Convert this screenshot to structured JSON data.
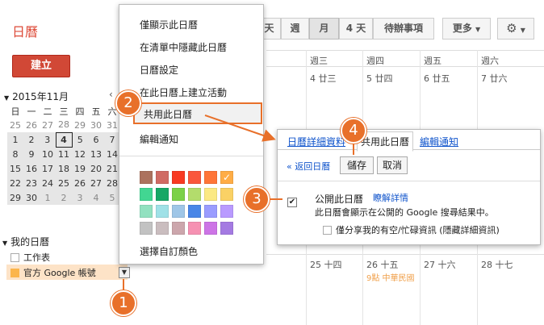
{
  "brand": "日曆",
  "create_label": "建立",
  "mini_cal": {
    "title": "2015年11月",
    "prev": "‹",
    "weekdays": [
      "日",
      "一",
      "二",
      "三",
      "四",
      "五",
      "六"
    ],
    "weeks": [
      [
        "25",
        "26",
        "27",
        "28",
        "29",
        "30",
        "31"
      ],
      [
        "1",
        "2",
        "3",
        "4",
        "5",
        "6",
        "7"
      ],
      [
        "8",
        "9",
        "10",
        "11",
        "12",
        "13",
        "14"
      ],
      [
        "15",
        "16",
        "17",
        "18",
        "19",
        "20",
        "21"
      ],
      [
        "22",
        "23",
        "24",
        "25",
        "26",
        "27",
        "28"
      ],
      [
        "29",
        "30",
        "1",
        "2",
        "3",
        "4",
        "5"
      ]
    ]
  },
  "my_calendars": {
    "title": "我的日曆",
    "items": [
      "工作表",
      "官方 Google 帳號"
    ]
  },
  "toolbar": {
    "day_label": "天",
    "week_label": "週",
    "month_label": "月",
    "four_days_label": "4 天",
    "agenda_label": "待辦事項",
    "more_label": "更多",
    "settings_icon": "⚙"
  },
  "grid": {
    "col_heads": [
      "週三",
      "週四",
      "週五",
      "週六"
    ],
    "row1": [
      "4 廿三",
      "5 廿四",
      "6 廿五",
      "7 廿六"
    ],
    "row5": [
      "25 十四",
      "26 十五",
      "27 十六",
      "28 十七"
    ],
    "event": "9點 中華民國"
  },
  "menu": {
    "items": [
      "僅顯示此日曆",
      "在清單中隱藏此日曆",
      "日曆設定",
      "在此日曆上建立活動",
      "共用此日曆",
      "編輯通知"
    ],
    "custom_color": "選擇自訂顏色",
    "colors": [
      [
        "#ac725e",
        "#d06b64",
        "#f83a22",
        "#fa573c",
        "#ff7537",
        "#ffad46"
      ],
      [
        "#42d692",
        "#16a765",
        "#7bd148",
        "#b3dc6c",
        "#fbe983",
        "#fad165"
      ],
      [
        "#92e1c0",
        "#9fe1e7",
        "#9fc6e7",
        "#4986e7",
        "#9a9cff",
        "#b99aff"
      ],
      [
        "#c2c2c2",
        "#cabdbf",
        "#cca6ac",
        "#f691b2",
        "#cd74e6",
        "#a47ae2"
      ]
    ]
  },
  "share_panel": {
    "tabs": [
      "日曆詳細資料",
      "共用此日曆",
      "編輯通知"
    ],
    "back_link": "« 返回日曆",
    "save_label": "儲存",
    "cancel_label": "取消",
    "public_label": "公開此日曆",
    "learn_more": "瞭解詳情",
    "public_desc": "此日曆會顯示在公開的 Google 搜尋結果中。",
    "busy_only": "僅分享我的有空/忙碌資訊 (隱藏詳細資訊)"
  },
  "markers": [
    "1",
    "2",
    "3",
    "4"
  ],
  "accent_color": "#e8702a"
}
